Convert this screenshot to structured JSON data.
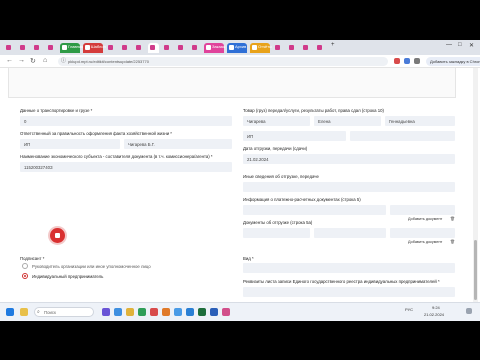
{
  "browser": {
    "tabs": [
      {
        "label": "",
        "color": "#d03a8a"
      },
      {
        "label": "",
        "color": "#d03a8a"
      },
      {
        "label": "",
        "color": "#d03a8a"
      },
      {
        "label": "",
        "color": "#d03a8a"
      },
      {
        "label": "Главная",
        "color": "#2e9a46"
      },
      {
        "label": "Шаблон",
        "color": "#d43b3b"
      },
      {
        "label": "",
        "color": "#d03a8a"
      },
      {
        "label": "",
        "color": "#d03a8a"
      },
      {
        "label": "",
        "color": "#d03a8a"
      },
      {
        "label": "",
        "color": "#d03a8a"
      },
      {
        "label": "",
        "color": "#d03a8a"
      },
      {
        "label": "",
        "color": "#d03a8a"
      },
      {
        "label": "",
        "color": "#d03a8a"
      },
      {
        "label": "Заказы",
        "color": "#e0439b"
      },
      {
        "label": "Архив",
        "color": "#2f6fd6"
      },
      {
        "label": "Отчёты",
        "color": "#e8a21a"
      },
      {
        "label": "",
        "color": "#d03a8a"
      },
      {
        "label": "",
        "color": "#d03a8a"
      },
      {
        "label": "",
        "color": "#d03a8a"
      },
      {
        "label": "",
        "color": "#d03a8a"
      }
    ],
    "url": "pklupd.mpt.ru/editkit/contentsupdate/2253770",
    "profile_label": "Добавить закладку в Chrome"
  },
  "form": {
    "transport_label": "Данные о транспортировке и грузе *",
    "transport_value": "0",
    "responsible_label": "Ответственный за правильность оформления факта хозяйственной жизни *",
    "responsible_field1": "ИП",
    "responsible_field2": "Чигарева Б.Г.",
    "economic_label": "Наименование экономического субъекта - составителя документа (в т.ч. комиссионера/агента) *",
    "economic_value": "11520032740З",
    "goods_label": "Товар (груз) передал/услуги, результаты работ, права сдал (строка 10)",
    "person_last": "Чигарева",
    "person_first": "Елена",
    "person_middle": "Геннадьевна",
    "ip_value": "ИП",
    "ship_date_label": "Дата отгрузки, передачи (сдачи)",
    "ship_date_value": "21.02.2024",
    "other_info_label": "Иные сведения об отгрузке, передаче",
    "legal_docs_label": "Информация о платежно-расчетных документах (строка 5)",
    "add_doc_1": "Добавить документ",
    "shipping_docs_label": "Документы об отгрузке (строка 5а)",
    "add_doc_2": "Добавить документ",
    "signer_label": "Подписант *",
    "signer_option1": "Руководитель организации или иное уполномоченное лицо",
    "signer_option2": "Индивидуальный предприниматель",
    "kind_label": "Вид *",
    "register_label": "Реквизиты листа записи Единого государственного реестра индивидуальных предпринимателей *"
  },
  "taskbar": {
    "search_placeholder": "Поиск",
    "lang": "РУС",
    "time": "9:24",
    "date": "21.02.2024"
  }
}
